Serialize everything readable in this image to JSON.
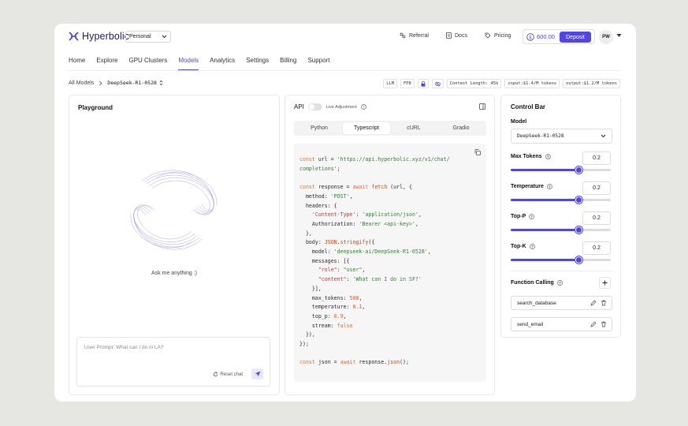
{
  "header": {
    "brand": "Hyperbolic",
    "workspace": "Personal",
    "links": {
      "referral": "Referral",
      "docs": "Docs",
      "pricing": "Pricing"
    },
    "credits": "600.00",
    "deposit": "Deposit",
    "avatar": "PW"
  },
  "nav": {
    "items": [
      "Home",
      "Explore",
      "GPU Clusters",
      "Models",
      "Analytics",
      "Settings",
      "Billing",
      "Support"
    ],
    "active": "Models"
  },
  "breadcrumb": {
    "root": "All Models",
    "model": "DeepSeek-R1-0528"
  },
  "tags": {
    "type": "LLM",
    "precision": "FP8",
    "context": "Context Length: 45k",
    "input": "input:$1.4/M tokens",
    "output": "output:$1.2/M tokens"
  },
  "playground": {
    "title": "Playground",
    "empty": "Ask me anything :)",
    "prompt_placeholder": "User Prompt: What can I do in LA?",
    "reset": "Reset chat"
  },
  "api": {
    "title": "API",
    "live": "Live Adjustment",
    "tabs": [
      "Python",
      "Typescript",
      "cURL",
      "Gradio"
    ],
    "active_tab": "Typescript",
    "code": {
      "l1a": "const",
      "l1b": " url = ",
      "l1c": "'https://api.hyperbolic.xyz/v1/chat/",
      "l2": "completions'",
      "l2b": ";",
      "l4a": "const",
      "l4b": " response = ",
      "l4c": "await",
      "l4d": "fetch",
      "l4e": " (url, {",
      "l5a": "  method: ",
      "l5b": "'POST'",
      "l5c": ",",
      "l6": "  headers: {",
      "l7a": "    ",
      "l7b": "'Content-Type'",
      "l7c": ": ",
      "l7d": "'application/json'",
      "l7e": ",",
      "l8a": "    Authorization: ",
      "l8b": "'Bearer <api-key>'",
      "l8c": ",",
      "l9": "  },",
      "l10a": "  body: ",
      "l10b": "JSON",
      "l10c": ".",
      "l10d": "stringify",
      "l10e": "({",
      "l11a": "    model: ",
      "l11b": "'deepseek-ai/DeepSeek-R1-0528'",
      "l11c": ",",
      "l12": "    messages: [{",
      "l13a": "      ",
      "l13b": "\"role\"",
      "l13c": ": ",
      "l13d": "\"user\"",
      "l13e": ",",
      "l14a": "      ",
      "l14b": "\"content\"",
      "l14c": ": ",
      "l14d": "'What can I do in SF?'",
      "l15": "    }],",
      "l16a": "    max_tokens: ",
      "l16b": "508",
      "l16c": ",",
      "l17a": "    temperature: ",
      "l17b": "0.1",
      "l17c": ",",
      "l18a": "    top_p: ",
      "l18b": "0.9",
      "l18c": ",",
      "l19a": "    stream: ",
      "l19b": "false",
      "l20": "  }),",
      "l21": "});",
      "l23a": "const",
      "l23b": " json = ",
      "l23c": "await",
      "l23d": " response.",
      "l23e": "json",
      "l23f": "();"
    }
  },
  "control": {
    "title": "Control Bar",
    "model_label": "Model",
    "model_value": "DeepSeek-R1-0528",
    "params": [
      {
        "label": "Max Tokens",
        "value": "0.2",
        "level": 0.68
      },
      {
        "label": "Temperature",
        "value": "0.2",
        "level": 0.68
      },
      {
        "label": "Top-P",
        "value": "0.2",
        "level": 0.68
      },
      {
        "label": "Top-K",
        "value": "0.2",
        "level": 0.68
      }
    ],
    "function_calling": "Function Calling",
    "functions": [
      "search_database",
      "send_email"
    ]
  },
  "colors": {
    "accent": "#4f46e5",
    "brand": "#1b1b6e"
  }
}
